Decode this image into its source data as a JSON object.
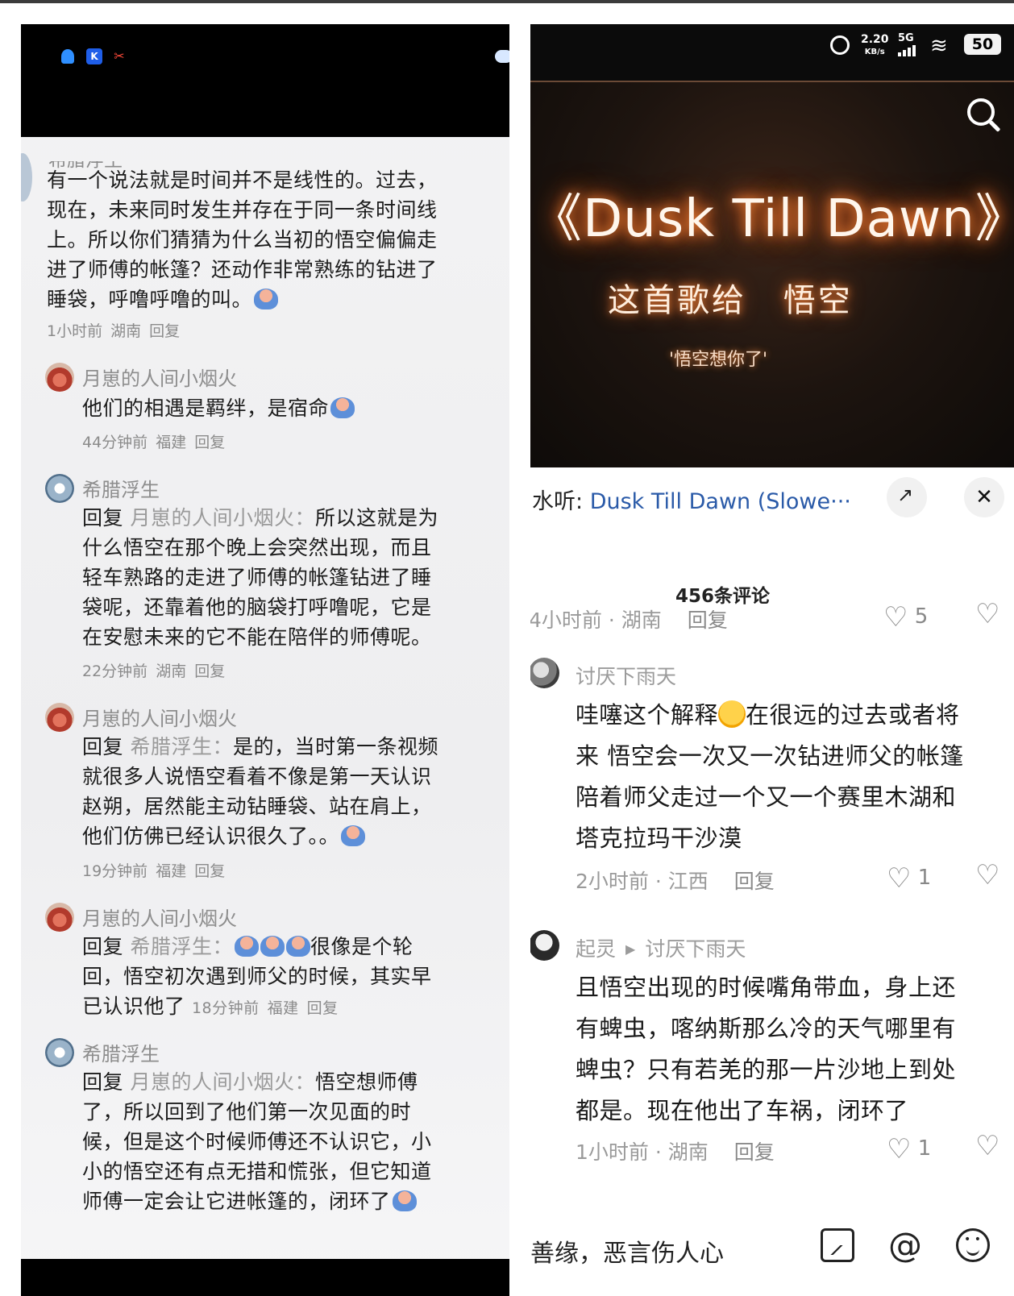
{
  "left": {
    "cut_name": "希腊浮生",
    "first_comment": {
      "lines": [
        "有一个说法就是时间并不是线性的。过去，",
        "现在，未来同时发生并存在于同一条时间线",
        "上。所以你们猜猜为什么当初的悟空偏偏走",
        "进了师傅的帐篷？还动作非常熟练的钻进了",
        "睡袋，呼噜呼噜的叫。"
      ],
      "time": "1小时前",
      "location": "湖南",
      "reply": "回复"
    },
    "replies": [
      {
        "name": "月崽的人间小烟火",
        "reply_prefix": "",
        "reply_to": "",
        "lines": [
          "他们的相遇是羁绊，是宿命"
        ],
        "time": "44分钟前",
        "location": "福建",
        "reply": "回复"
      },
      {
        "name": "希腊浮生",
        "reply_prefix": "回复",
        "reply_to": "月崽的人间小烟火：",
        "lines": [
          "所以这就是为",
          "什么悟空在那个晚上会突然出现，而且",
          "轻车熟路的走进了师傅的帐篷钻进了睡",
          "袋呢，还靠着他的脑袋打呼噜呢，它是",
          "在安慰未来的它不能在陪伴的师傅呢。"
        ],
        "time": "22分钟前",
        "location": "湖南",
        "reply": "回复"
      },
      {
        "name": "月崽的人间小烟火",
        "reply_prefix": "回复",
        "reply_to": "希腊浮生：",
        "lines": [
          "是的，当时第一条视频",
          "就很多人说悟空看着不像是第一天认识",
          "赵朔，居然能主动钻睡袋、站在肩上，",
          "他们仿佛已经认识很久了。。"
        ],
        "time": "19分钟前",
        "location": "福建",
        "reply": "回复"
      },
      {
        "name": "月崽的人间小烟火",
        "reply_prefix": "回复",
        "reply_to": "希腊浮生：",
        "lines": [
          "很像是个轮",
          "回，悟空初次遇到师父的时候，其实早",
          "已认识他了"
        ],
        "time": "18分钟前",
        "location": "福建",
        "reply": "回复"
      },
      {
        "name": "希腊浮生",
        "reply_prefix": "回复",
        "reply_to": "月崽的人间小烟火：",
        "lines": [
          "悟空想师傅",
          "了，所以回到了他们第一次见面的时",
          "候，但是这个时候师傅还不认识它，小",
          "小的悟空还有点无措和慌张，但它知道",
          "师傅一定会让它进帐篷的，闭环了"
        ]
      }
    ]
  },
  "right": {
    "status": {
      "speed_value": "2.20",
      "speed_unit": "KB/s",
      "network": "5G",
      "battery": "50"
    },
    "video": {
      "title": "《Dusk Till Dawn》",
      "subtitle_a": "这首歌给",
      "subtitle_b": "悟空",
      "quote": "'悟空想你了'"
    },
    "listen": {
      "prefix": "水听: ",
      "song": "Dusk Till Dawn (Slowe···"
    },
    "comment_count": "456条评论",
    "first_meta": {
      "time": "4小时前 · 湖南",
      "reply": "回复",
      "likes": "5"
    },
    "comments": [
      {
        "name": "讨厌下雨天",
        "reply_to": "",
        "lines": [
          "哇噻这个解释",
          "在很远的过去或者将",
          "来 悟空会一次又一次钻进师父的帐篷",
          "陪着师父走过一个又一个赛里木湖和",
          "塔克拉玛干沙漠"
        ],
        "time": "2小时前 · 江西",
        "reply": "回复",
        "likes": "1"
      },
      {
        "name": "起灵",
        "reply_to": "讨厌下雨天",
        "lines": [
          "且悟空出现的时候嘴角带血，身上还",
          "有蜱虫，喀纳斯那么冷的天气哪里有",
          "蜱虫？只有若羌的那一片沙地上到处",
          "都是。现在他出了车祸，闭环了"
        ],
        "time": "1小时前 · 湖南",
        "reply": "回复",
        "likes": "1"
      }
    ],
    "input_text": "善缘，恶言伤人心"
  }
}
